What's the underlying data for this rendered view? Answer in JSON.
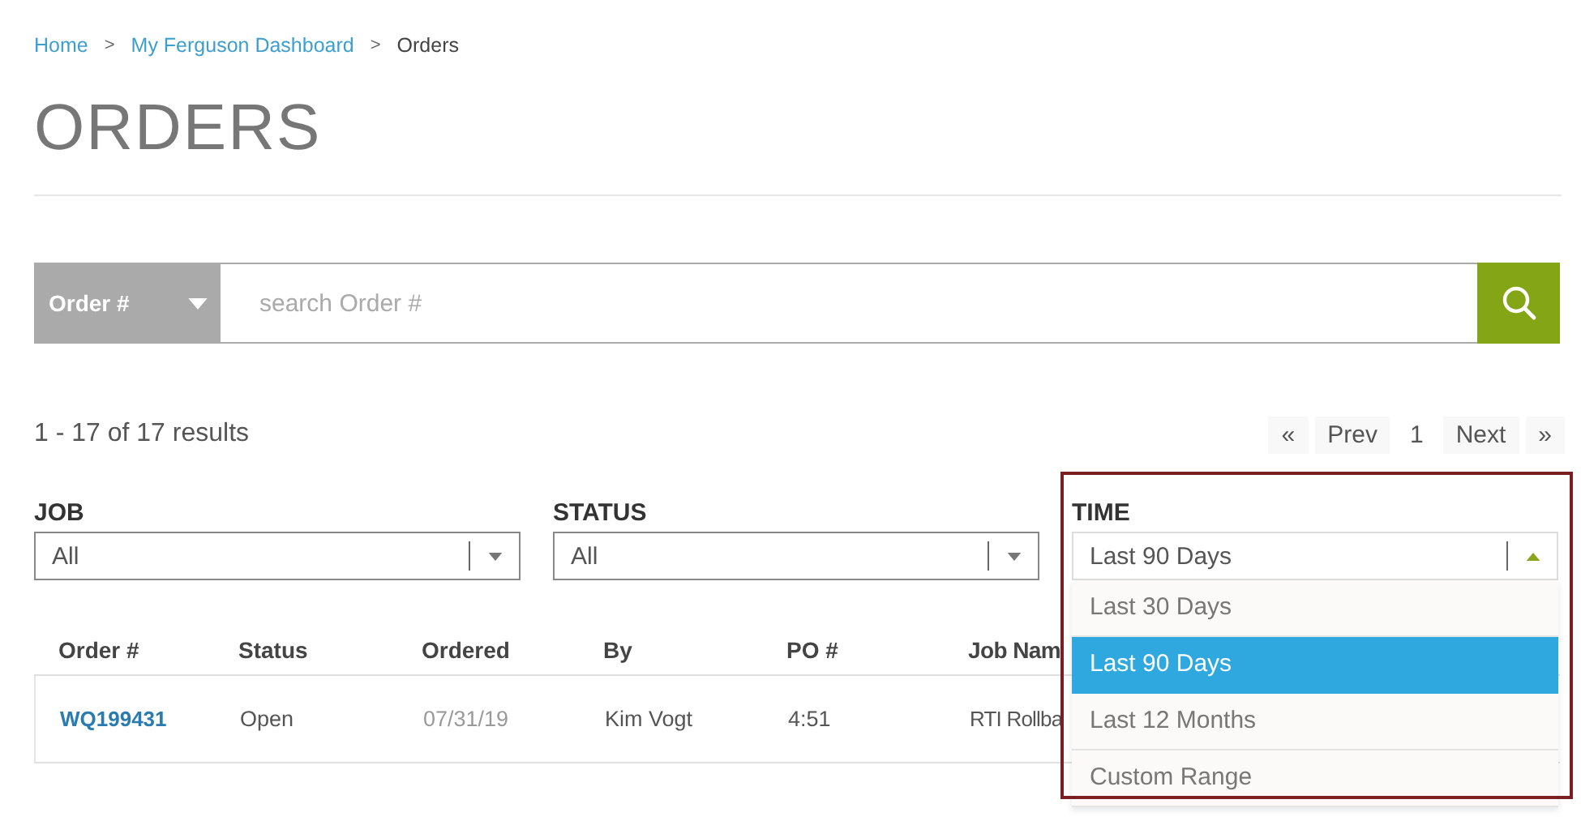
{
  "breadcrumb": [
    {
      "label": "Home",
      "link": true
    },
    {
      "label": "My Ferguson Dashboard",
      "link": true
    },
    {
      "label": "Orders",
      "link": false
    }
  ],
  "breadcrumb_separator": ">",
  "title": "ORDERS",
  "search": {
    "scope": "Order #",
    "placeholder": "search Order #"
  },
  "results": "1 - 17 of 17 results",
  "pagination": {
    "first": "«",
    "prev": "Prev",
    "page": "1",
    "next": "Next",
    "last": "»"
  },
  "filters": [
    {
      "label": "JOB",
      "value": "All",
      "expanded": false
    },
    {
      "label": "STATUS",
      "value": "All",
      "expanded": false
    },
    {
      "label": "TIME",
      "value": "Last 90 Days",
      "expanded": true,
      "highlighted": true,
      "options": [
        {
          "label": "Last 30 Days",
          "selected": false
        },
        {
          "label": "Last 90 Days",
          "selected": true
        },
        {
          "label": "Last 12 Months",
          "selected": false
        },
        {
          "label": "Custom Range",
          "selected": false
        }
      ]
    }
  ],
  "table": {
    "columns": [
      "Order #",
      "Status",
      "Ordered",
      "By",
      "PO #",
      "Job Nam"
    ],
    "rows": [
      [
        "WQ199431",
        "Open",
        "07/31/19",
        "Kim Vogt",
        "4:51",
        "RTI Rollba"
      ]
    ]
  }
}
